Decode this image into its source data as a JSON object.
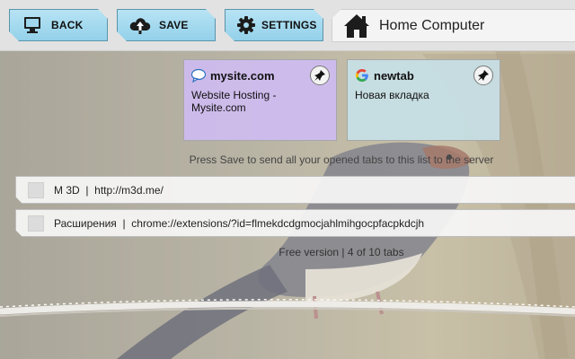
{
  "toolbar": {
    "back_label": "BACK",
    "save_label": "SAVE",
    "settings_label": "SETTINGS",
    "device_name": "Home Computer",
    "icons": {
      "back": "monitor-icon",
      "save": "cloud-upload-icon",
      "settings": "gear-icon",
      "device": "house-icon"
    },
    "button_color": "#a8dcf0"
  },
  "bookmarks": [
    {
      "title": "mysite.com",
      "description": "Website Hosting - Mysite.com",
      "favicon": "chat-bubble-icon",
      "background": "#cdbcee"
    },
    {
      "title": "newtab",
      "description": "Новая вкладка",
      "favicon": "google-g-icon",
      "background": "#c6dee4"
    }
  ],
  "hint": "Press Save to send all your opened tabs to this list to the server",
  "tabs": [
    {
      "title": "M 3D",
      "url": "http://m3d.me/",
      "checked": false
    },
    {
      "title": "Расширения",
      "url": "chrome://extensions/?id=flmekdcdgmocjahlmihgocpfacpkdcjh",
      "checked": false
    }
  ],
  "separator": "|",
  "status": "Free version | 4 of 10 tabs"
}
